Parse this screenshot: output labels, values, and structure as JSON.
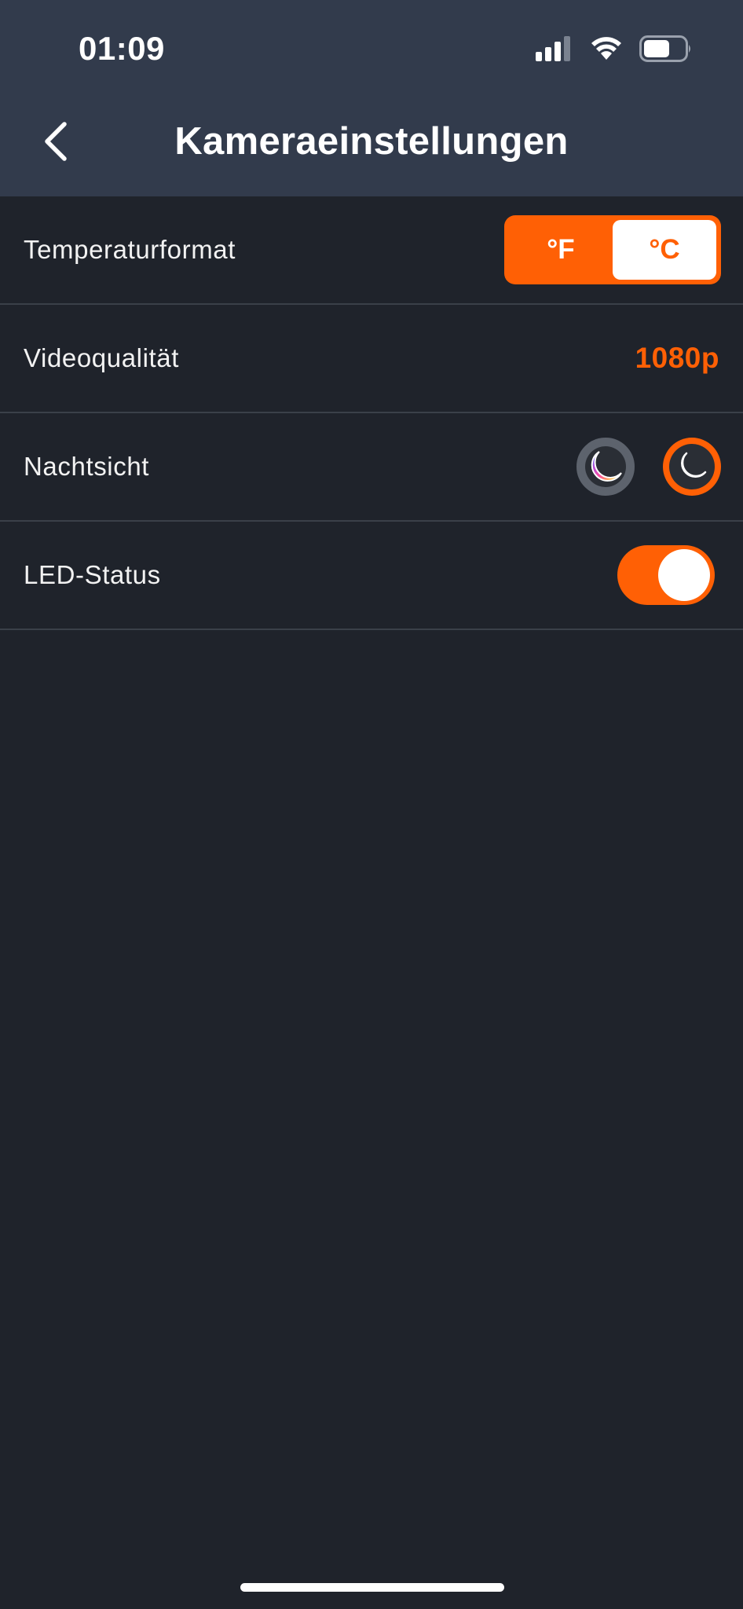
{
  "status_bar": {
    "time": "01:09",
    "icons": [
      "cellular-signal-icon",
      "wifi-icon",
      "battery-icon"
    ],
    "battery_level": 0.55
  },
  "header": {
    "back_icon": "chevron-left-icon",
    "title": "Kameraeinstellungen"
  },
  "settings": {
    "temperature": {
      "label": "Temperaturformat",
      "options": [
        "°F",
        "°C"
      ],
      "selected": "°C"
    },
    "video": {
      "label": "Videoqualität",
      "value": "1080p"
    },
    "night_vision": {
      "label": "Nachtsicht",
      "options": [
        "color-night-vision-icon",
        "black-white-night-vision-icon"
      ],
      "selected": "black-white-night-vision-icon"
    },
    "led": {
      "label": "LED-Status",
      "enabled": true
    }
  },
  "colors": {
    "accent": "#ff6005",
    "header_bg": "#323b4c",
    "page_bg": "#1f232b",
    "divider": "#3a4049"
  }
}
